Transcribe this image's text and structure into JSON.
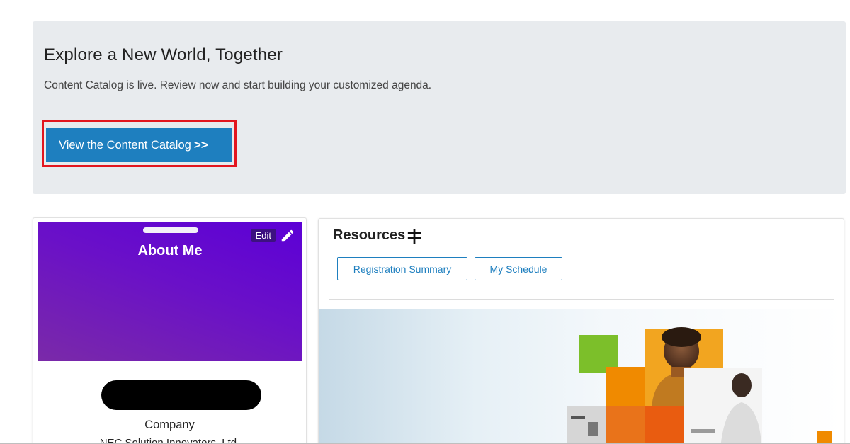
{
  "banner": {
    "title": "Explore a New World, Together",
    "subtitle": "Content Catalog is live. Review now and start building your customized agenda.",
    "cta_label": "View the Content Catalog",
    "cta_arrows": ">>",
    "cta_color": "#1e7fbf",
    "highlight_color": "#e3161f"
  },
  "about": {
    "title": "About Me",
    "edit_label": "Edit",
    "company_label": "Company",
    "company_value": "NEC Solution Innovators, Ltd.",
    "header_color": "#6a10c8",
    "icons": [
      "pencil-icon"
    ]
  },
  "resources": {
    "title": "Resources",
    "buttons": [
      {
        "label": "Registration Summary"
      },
      {
        "label": "My Schedule"
      }
    ],
    "icons": [
      "signpost-icon"
    ]
  }
}
